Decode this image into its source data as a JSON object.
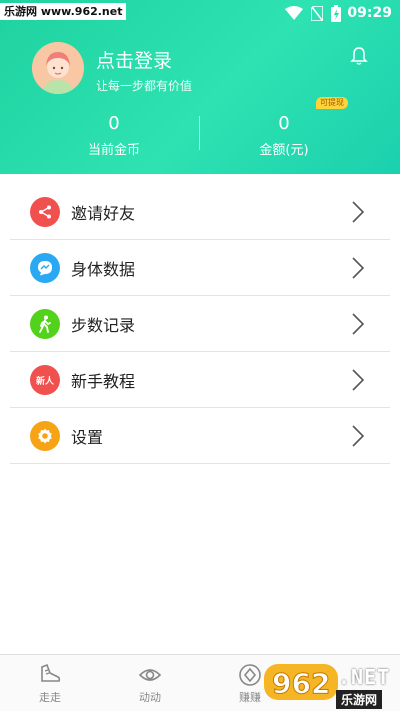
{
  "status_bar": {
    "watermark": "乐游网 www.962.net",
    "time": "09:29"
  },
  "profile": {
    "title": "点击登录",
    "subtitle": "让每一步都有价值"
  },
  "stats": {
    "coins_value": "0",
    "coins_label": "当前金币",
    "amount_value": "0",
    "amount_label": "金额(元)",
    "withdraw_badge": "可提现"
  },
  "menu": [
    {
      "label": "邀请好友",
      "icon": "share-icon",
      "color": "#f0514f"
    },
    {
      "label": "身体数据",
      "icon": "chat-pulse-icon",
      "color": "#2aa9f2"
    },
    {
      "label": "步数记录",
      "icon": "walking-icon",
      "color": "#52d21a"
    },
    {
      "label": "新手教程",
      "icon": "novice-icon",
      "color": "#f0514f",
      "icon_text": "新人"
    },
    {
      "label": "设置",
      "icon": "gear-icon",
      "color": "#f7a316"
    }
  ],
  "tabbar": [
    {
      "label": "走走",
      "icon": "shoe-icon"
    },
    {
      "label": "动动",
      "icon": "eye-icon"
    },
    {
      "label": "赚赚",
      "icon": "coin-icon"
    }
  ],
  "watermark_logo": {
    "brand": "962",
    "suffix": ".NET",
    "site": "乐游网"
  },
  "colors": {
    "header_green": "#26dcab",
    "accent_yellow": "#ffd33a"
  }
}
